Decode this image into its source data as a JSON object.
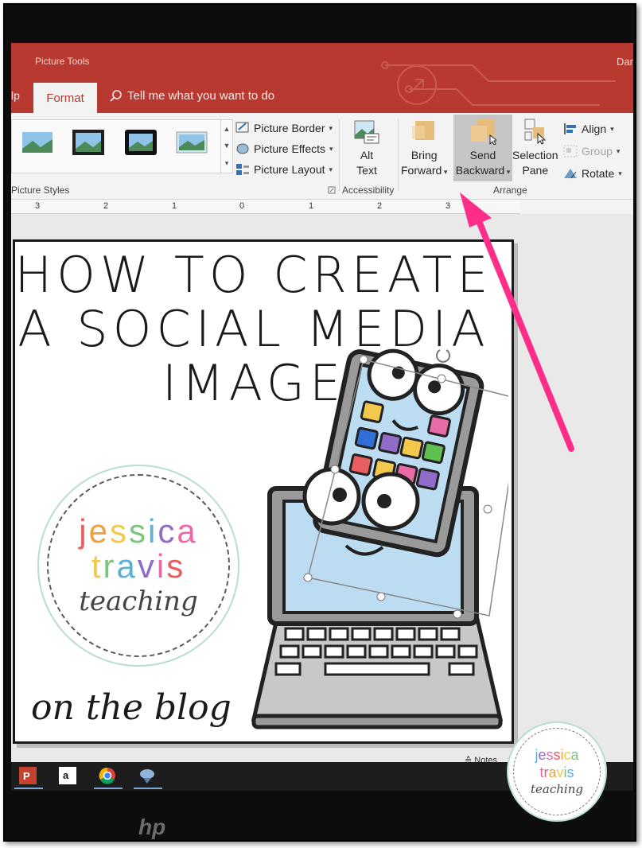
{
  "title_bar": {
    "context_tab": "Picture Tools",
    "user_name_fragment": "Dar",
    "tab_help_fragment": "lp",
    "tab_format": "Format",
    "tell_me": "Tell me what you want to do"
  },
  "ribbon": {
    "picture_styles_label": "Picture Styles",
    "picture_border": "Picture Border",
    "picture_effects": "Picture Effects",
    "picture_layout": "Picture Layout",
    "alt_text_line1": "Alt",
    "alt_text_line2": "Text",
    "accessibility_label": "Accessibility",
    "bring_forward_line1": "Bring",
    "bring_forward_line2": "Forward",
    "send_backward_line1": "Send",
    "send_backward_line2": "Backward",
    "selection_pane_line1": "Selection",
    "selection_pane_line2": "Pane",
    "align": "Align",
    "group": "Group",
    "rotate": "Rotate",
    "arrange_label": "Arrange"
  },
  "ruler": {
    "marks": [
      "3",
      "2",
      "1",
      "0",
      "1",
      "2",
      "3"
    ]
  },
  "slide": {
    "title_line1": "HOW TO CREATE",
    "title_line2": "A SOCIAL MEDIA",
    "title_line3": "IMAGE",
    "logo_line1": "jessica",
    "logo_line2": "travis",
    "logo_line3": "teaching",
    "footer_script": "on the blog"
  },
  "status": {
    "notes": "Notes"
  },
  "watermark": {
    "line1": "jessica",
    "line2": "travis",
    "line3": "teaching"
  },
  "colors": {
    "ribbon_red": "#b7392f",
    "highlight_arrow": "#ff2d8a",
    "logo_letters": [
      "#e85d5d",
      "#f2a03c",
      "#f2c94c",
      "#7bc67b",
      "#5ab0d8",
      "#8e6cc7",
      "#e86aa6"
    ]
  },
  "taskbar": {
    "icons": [
      "powerpoint-icon",
      "amazon-icon",
      "chrome-icon",
      "app-icon"
    ]
  },
  "brand": {
    "hp": "hp"
  }
}
